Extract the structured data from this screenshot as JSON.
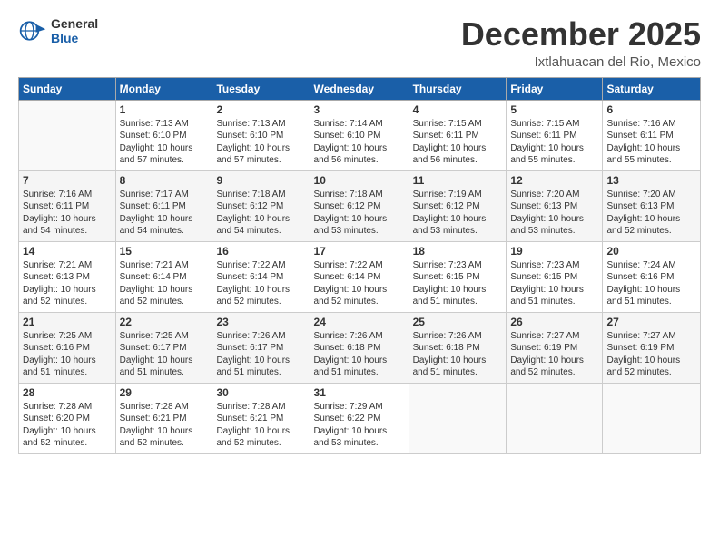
{
  "logo": {
    "line1": "General",
    "line2": "Blue"
  },
  "title": "December 2025",
  "subtitle": "Ixtlahuacan del Rio, Mexico",
  "header": {
    "days": [
      "Sunday",
      "Monday",
      "Tuesday",
      "Wednesday",
      "Thursday",
      "Friday",
      "Saturday"
    ]
  },
  "weeks": [
    [
      {
        "day": "",
        "info": ""
      },
      {
        "day": "1",
        "info": "Sunrise: 7:13 AM\nSunset: 6:10 PM\nDaylight: 10 hours\nand 57 minutes."
      },
      {
        "day": "2",
        "info": "Sunrise: 7:13 AM\nSunset: 6:10 PM\nDaylight: 10 hours\nand 57 minutes."
      },
      {
        "day": "3",
        "info": "Sunrise: 7:14 AM\nSunset: 6:10 PM\nDaylight: 10 hours\nand 56 minutes."
      },
      {
        "day": "4",
        "info": "Sunrise: 7:15 AM\nSunset: 6:11 PM\nDaylight: 10 hours\nand 56 minutes."
      },
      {
        "day": "5",
        "info": "Sunrise: 7:15 AM\nSunset: 6:11 PM\nDaylight: 10 hours\nand 55 minutes."
      },
      {
        "day": "6",
        "info": "Sunrise: 7:16 AM\nSunset: 6:11 PM\nDaylight: 10 hours\nand 55 minutes."
      }
    ],
    [
      {
        "day": "7",
        "info": "Sunrise: 7:16 AM\nSunset: 6:11 PM\nDaylight: 10 hours\nand 54 minutes."
      },
      {
        "day": "8",
        "info": "Sunrise: 7:17 AM\nSunset: 6:11 PM\nDaylight: 10 hours\nand 54 minutes."
      },
      {
        "day": "9",
        "info": "Sunrise: 7:18 AM\nSunset: 6:12 PM\nDaylight: 10 hours\nand 54 minutes."
      },
      {
        "day": "10",
        "info": "Sunrise: 7:18 AM\nSunset: 6:12 PM\nDaylight: 10 hours\nand 53 minutes."
      },
      {
        "day": "11",
        "info": "Sunrise: 7:19 AM\nSunset: 6:12 PM\nDaylight: 10 hours\nand 53 minutes."
      },
      {
        "day": "12",
        "info": "Sunrise: 7:20 AM\nSunset: 6:13 PM\nDaylight: 10 hours\nand 53 minutes."
      },
      {
        "day": "13",
        "info": "Sunrise: 7:20 AM\nSunset: 6:13 PM\nDaylight: 10 hours\nand 52 minutes."
      }
    ],
    [
      {
        "day": "14",
        "info": "Sunrise: 7:21 AM\nSunset: 6:13 PM\nDaylight: 10 hours\nand 52 minutes."
      },
      {
        "day": "15",
        "info": "Sunrise: 7:21 AM\nSunset: 6:14 PM\nDaylight: 10 hours\nand 52 minutes."
      },
      {
        "day": "16",
        "info": "Sunrise: 7:22 AM\nSunset: 6:14 PM\nDaylight: 10 hours\nand 52 minutes."
      },
      {
        "day": "17",
        "info": "Sunrise: 7:22 AM\nSunset: 6:14 PM\nDaylight: 10 hours\nand 52 minutes."
      },
      {
        "day": "18",
        "info": "Sunrise: 7:23 AM\nSunset: 6:15 PM\nDaylight: 10 hours\nand 51 minutes."
      },
      {
        "day": "19",
        "info": "Sunrise: 7:23 AM\nSunset: 6:15 PM\nDaylight: 10 hours\nand 51 minutes."
      },
      {
        "day": "20",
        "info": "Sunrise: 7:24 AM\nSunset: 6:16 PM\nDaylight: 10 hours\nand 51 minutes."
      }
    ],
    [
      {
        "day": "21",
        "info": "Sunrise: 7:25 AM\nSunset: 6:16 PM\nDaylight: 10 hours\nand 51 minutes."
      },
      {
        "day": "22",
        "info": "Sunrise: 7:25 AM\nSunset: 6:17 PM\nDaylight: 10 hours\nand 51 minutes."
      },
      {
        "day": "23",
        "info": "Sunrise: 7:26 AM\nSunset: 6:17 PM\nDaylight: 10 hours\nand 51 minutes."
      },
      {
        "day": "24",
        "info": "Sunrise: 7:26 AM\nSunset: 6:18 PM\nDaylight: 10 hours\nand 51 minutes."
      },
      {
        "day": "25",
        "info": "Sunrise: 7:26 AM\nSunset: 6:18 PM\nDaylight: 10 hours\nand 51 minutes."
      },
      {
        "day": "26",
        "info": "Sunrise: 7:27 AM\nSunset: 6:19 PM\nDaylight: 10 hours\nand 52 minutes."
      },
      {
        "day": "27",
        "info": "Sunrise: 7:27 AM\nSunset: 6:19 PM\nDaylight: 10 hours\nand 52 minutes."
      }
    ],
    [
      {
        "day": "28",
        "info": "Sunrise: 7:28 AM\nSunset: 6:20 PM\nDaylight: 10 hours\nand 52 minutes."
      },
      {
        "day": "29",
        "info": "Sunrise: 7:28 AM\nSunset: 6:21 PM\nDaylight: 10 hours\nand 52 minutes."
      },
      {
        "day": "30",
        "info": "Sunrise: 7:28 AM\nSunset: 6:21 PM\nDaylight: 10 hours\nand 52 minutes."
      },
      {
        "day": "31",
        "info": "Sunrise: 7:29 AM\nSunset: 6:22 PM\nDaylight: 10 hours\nand 53 minutes."
      },
      {
        "day": "",
        "info": ""
      },
      {
        "day": "",
        "info": ""
      },
      {
        "day": "",
        "info": ""
      }
    ]
  ]
}
